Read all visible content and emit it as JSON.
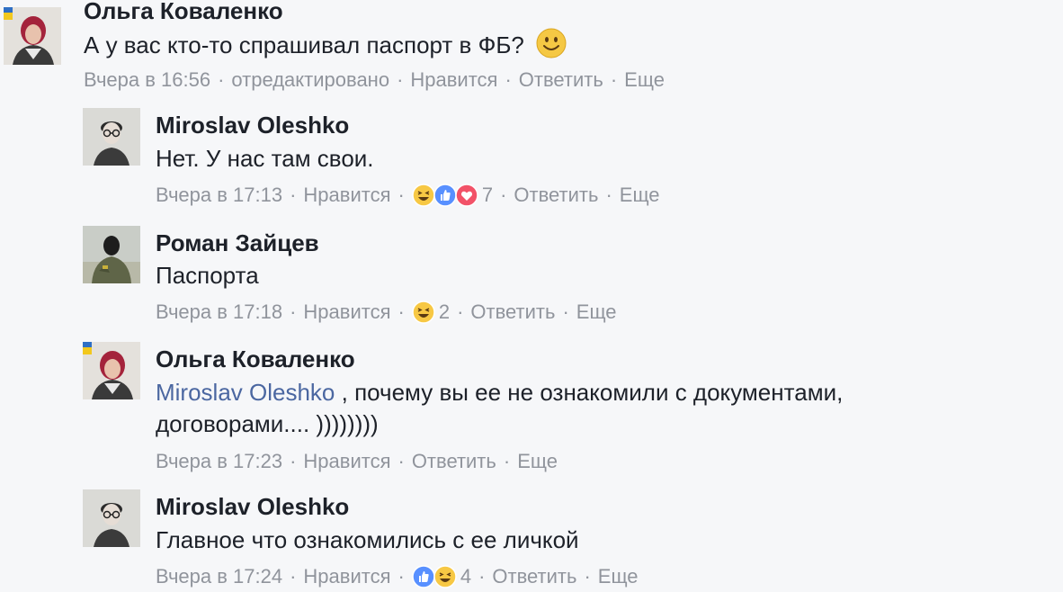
{
  "comments": [
    {
      "author": "Ольга Коваленко",
      "text": "А у вас кто-то спрашивал паспорт в ФБ?",
      "emoji": "slightly-smiling-face",
      "time": "Вчера в 16:56",
      "edited": "отредактировано",
      "like": "Нравится",
      "reply": "Ответить",
      "more": "Еще"
    },
    {
      "author": "Miroslav Oleshko",
      "text": "Нет. У нас там свои.",
      "time": "Вчера в 17:13",
      "like": "Нравится",
      "reactions": [
        "haha",
        "like",
        "love"
      ],
      "reaction_count": "7",
      "reply": "Ответить",
      "more": "Еще"
    },
    {
      "author": "Роман Зайцев",
      "text": "Паспорта",
      "time": "Вчера в 17:18",
      "like": "Нравится",
      "reactions": [
        "haha"
      ],
      "reaction_count": "2",
      "reply": "Ответить",
      "more": "Еще"
    },
    {
      "author": "Ольга Коваленко",
      "mention": "Miroslav Oleshko",
      "text_line1": " , почему вы ее не ознакомили с документами,",
      "text_line2": "договорами.... ))))))))",
      "time": "Вчера в 17:23",
      "like": "Нравится",
      "reply": "Ответить",
      "more": "Еще"
    },
    {
      "author": "Miroslav Oleshko",
      "text": "Главное что ознакомились с ее личкой",
      "time": "Вчера в 17:24",
      "like": "Нравится",
      "reactions": [
        "like",
        "haha"
      ],
      "reaction_count": "4",
      "reply": "Ответить",
      "more": "Еще"
    }
  ],
  "colors": {
    "link": "#4b67a1",
    "meta": "#90949c",
    "text": "#1d2129",
    "like_blue": "#5890ff",
    "love_red": "#f25268",
    "haha_yellow": "#f7c844"
  },
  "separator": "·"
}
